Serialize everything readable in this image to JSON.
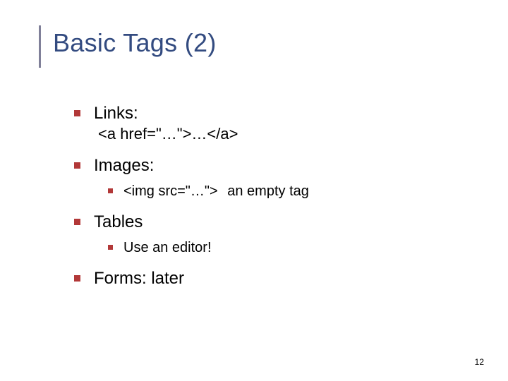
{
  "title": "Basic Tags (2)",
  "items": {
    "links": {
      "label": "Links:",
      "code": "<a href=\"…\">…</a>"
    },
    "images": {
      "label": "Images:",
      "sub_code": "<img src=\"…\">",
      "sub_note": "an empty tag"
    },
    "tables": {
      "label": "Tables",
      "sub": "Use an editor!"
    },
    "forms": {
      "label": "Forms: later"
    }
  },
  "page_number": "12"
}
